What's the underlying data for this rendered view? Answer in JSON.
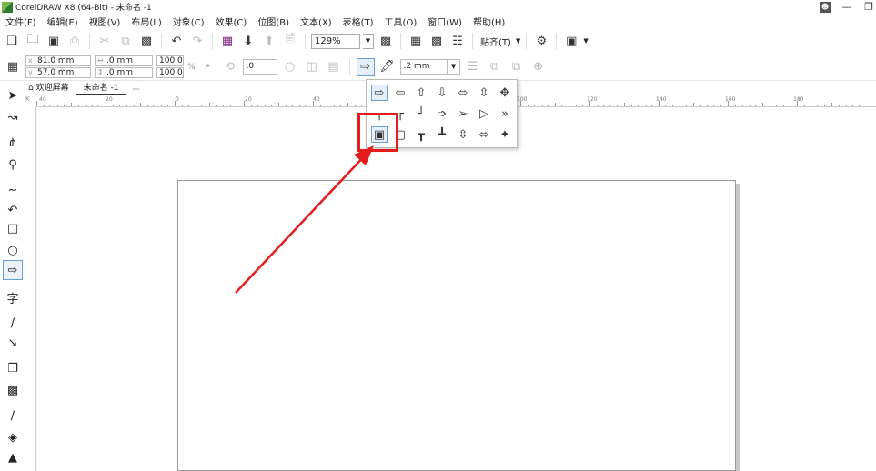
{
  "window": {
    "title": "CorelDRAW X8 (64-Bit) - 未命名 -1"
  },
  "menu": {
    "items": [
      {
        "label": "文件(F)"
      },
      {
        "label": "编辑(E)"
      },
      {
        "label": "视图(V)"
      },
      {
        "label": "布局(L)"
      },
      {
        "label": "对象(C)"
      },
      {
        "label": "效果(C)"
      },
      {
        "label": "位图(B)"
      },
      {
        "label": "文本(X)"
      },
      {
        "label": "表格(T)"
      },
      {
        "label": "工具(O)"
      },
      {
        "label": "窗口(W)"
      },
      {
        "label": "帮助(H)"
      }
    ]
  },
  "toolbar": {
    "zoom": "129%",
    "snap_label": "贴齐(T)"
  },
  "property_bar": {
    "x": "81.0 mm",
    "y": "57.0 mm",
    "width": ".0 mm",
    "height": ".0 mm",
    "scale_x": "100.0",
    "scale_y": "100.0",
    "angle": ".0",
    "outline_width": ".2 mm",
    "pct_sign": "%"
  },
  "tabs": {
    "welcome": "欢迎屏幕",
    "document": "未命名 -1",
    "add": "+"
  },
  "ruler": {
    "h_labels": [
      "40",
      "20",
      "0",
      "20",
      "40",
      "100",
      "120",
      "140",
      "160",
      "180"
    ],
    "unit": "K"
  },
  "flyout": {
    "rows": [
      [
        "arrow-right-outline-icon",
        "arrow-left-outline-icon",
        "arrow-up-outline-icon",
        "arrow-down-outline-icon",
        "arrow-left-right-outline-icon",
        "arrow-up-down-outline-icon",
        "arrow-four-way-outline-icon"
      ],
      [
        "elbow-down-left-icon",
        "elbow-down-right-icon",
        "elbow-up-right-icon",
        "arrow-right-notched-icon",
        "arrow-right-pentagon-icon",
        "triangle-right-icon",
        "chevron-double-right-icon"
      ],
      [
        "callout-arrow-right-icon",
        "callout-arrow-left-icon",
        "callout-arrow-up-icon",
        "callout-arrow-down-icon",
        "callout-arrow-up-down-icon",
        "callout-arrow-left-right-icon",
        "callout-arrow-four-way-icon"
      ]
    ],
    "selected": "callout-arrow-right-icon"
  },
  "colors": {
    "annotation": "#e31b1b",
    "selection_border": "#6aa0d8",
    "selection_fill": "#e6f0fb"
  }
}
